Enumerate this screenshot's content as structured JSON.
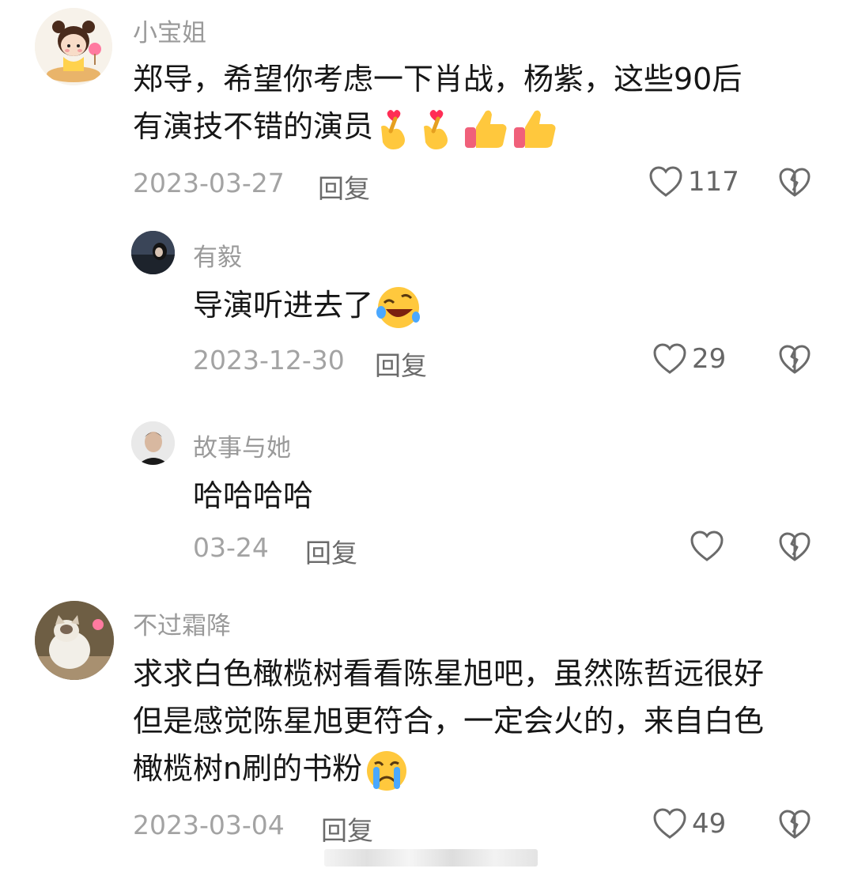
{
  "comments": [
    {
      "username": "小宝姐",
      "text_lines": [
        "郑导，希望你考虑一下肖战，杨紫，这些90后",
        "有演技不错的演员"
      ],
      "date": "2023-03-27",
      "reply": "回复",
      "likes": "117"
    },
    {
      "username": "有毅",
      "text_lines": [
        "导演听进去了"
      ],
      "date": "2023-12-30",
      "reply": "回复",
      "likes": "29"
    },
    {
      "username": "故事与她",
      "text_lines": [
        "哈哈哈哈"
      ],
      "date": "03-24",
      "reply": "回复",
      "likes": ""
    },
    {
      "username": "不过霜降",
      "text_lines": [
        "求求白色橄榄树看看陈星旭吧，虽然陈哲远很好",
        "但是感觉陈星旭更符合，一定会火的，来自白色",
        "橄榄树n刷的书粉"
      ],
      "date": "2023-03-04",
      "reply": "回复",
      "likes": "49"
    }
  ],
  "icons": {
    "like": "heart-outline-icon",
    "dislike": "broken-heart-icon",
    "emoji_1": "finger-heart-emoji",
    "emoji_2": "thumbs-up-emoji",
    "emoji_3": "rolling-laughing-emoji",
    "emoji_4": "crying-face-emoji"
  },
  "colors": {
    "username": "#9a9a9a",
    "date": "#a3a3a3",
    "reply": "#6b6b6b",
    "icon": "#6a6a6a"
  }
}
